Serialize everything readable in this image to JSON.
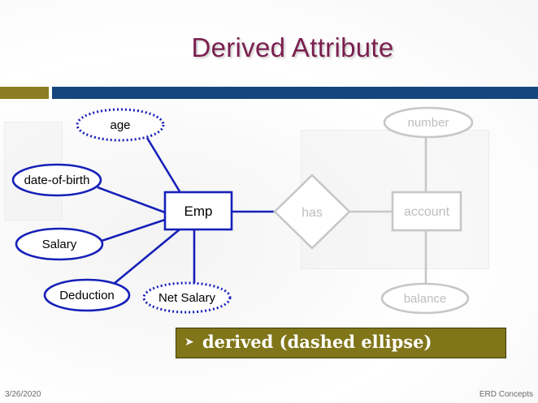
{
  "slide": {
    "title": "Derived Attribute",
    "callout": {
      "arrow": "➤",
      "text": "derived (dashed ellipse)"
    },
    "footer": {
      "date": "3/26/2020",
      "topic": "ERD Concepts"
    }
  },
  "diagram": {
    "emp_entity": "Emp",
    "attributes": {
      "age": "age",
      "date_of_birth": "date-of-birth",
      "salary": "Salary",
      "deduction": "Deduction",
      "net_salary": "Net Salary"
    },
    "relationship": "has",
    "account_entity": "account",
    "account_attributes": {
      "number": "number",
      "balance": "balance"
    }
  },
  "colors": {
    "title": "#7a1f4e",
    "active_stroke": "#1620b8",
    "faded_stroke": "#c7c7c7",
    "faded_text": "#bdbdbd",
    "bar_olive": "#8c7d24",
    "bar_navy": "#15467d",
    "callout_bg": "#807518"
  }
}
